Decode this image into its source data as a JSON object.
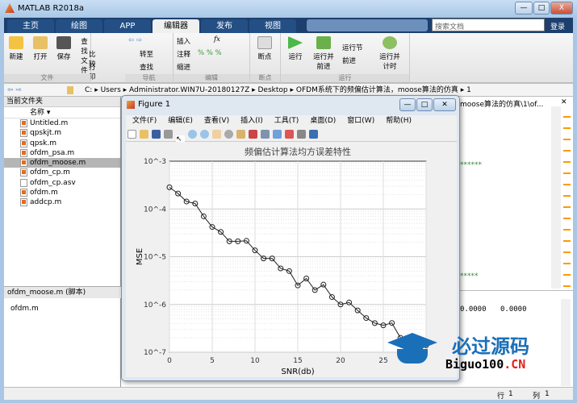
{
  "app": {
    "title": "MATLAB R2018a",
    "min": "—",
    "max": "□",
    "close": "X"
  },
  "tabs": [
    "主页",
    "绘图",
    "APP",
    "编辑器",
    "发布",
    "视图"
  ],
  "search": {
    "placeholder": "搜索文档"
  },
  "login": "登录",
  "ribbon": {
    "file": {
      "new": "新建",
      "open": "打开",
      "save": "保存",
      "find_files": "查找文件",
      "compare": "比较",
      "print": "打印",
      "label": "文件"
    },
    "nav": {
      "goto": "转至",
      "find": "查找",
      "label": "导航"
    },
    "edit": {
      "insert": "插入",
      "comment": "注释",
      "indent": "缩进",
      "fx": "fx",
      "label": "编辑"
    },
    "breakpoints": {
      "bp": "断点",
      "label": "断点"
    },
    "run": {
      "run": "运行",
      "run_advance": "运行并前进",
      "run_section": "运行节",
      "advance": "前进",
      "run_time": "运行并计时",
      "label": "运行"
    }
  },
  "address": {
    "path": [
      "C:",
      "Users",
      "Administrator.WIN7U-20180127Z",
      "Desktop",
      "OFDM系统下的频偏估计算法，moose算法的仿真",
      "1"
    ]
  },
  "current_folder": {
    "title": "当前文件夹",
    "column": "名称",
    "files": [
      {
        "name": "Untitled.m",
        "type": "m"
      },
      {
        "name": "qpskjt.m",
        "type": "m"
      },
      {
        "name": "qpsk.m",
        "type": "m"
      },
      {
        "name": "ofdm_psa.m",
        "type": "m"
      },
      {
        "name": "ofdm_moose.m",
        "type": "m",
        "selected": true
      },
      {
        "name": "ofdm_cp.m",
        "type": "m"
      },
      {
        "name": "ofdm_cp.asv",
        "type": "asv"
      },
      {
        "name": "ofdm.m",
        "type": "m"
      },
      {
        "name": "addcp.m",
        "type": "m"
      }
    ]
  },
  "details": {
    "title": "ofdm_moose.m  (脚本)",
    "content": "ofdm.m"
  },
  "editor": {
    "tab_title": "moose算法的仿真\\1\\of...",
    "stars1": "******",
    "stars2": "*****"
  },
  "command": {
    "v1": "0.0000",
    "v2": "0.0000"
  },
  "status": {
    "row_label": "行",
    "row": "1",
    "col_label": "列",
    "col": "1"
  },
  "figure": {
    "title": "Figure 1",
    "menu": [
      "文件(F)",
      "编辑(E)",
      "查看(V)",
      "插入(I)",
      "工具(T)",
      "桌面(D)",
      "窗口(W)",
      "帮助(H)"
    ]
  },
  "watermark": {
    "cn": "必过源码",
    "en": "Biguo100",
    "tld": ".CN"
  },
  "chart_data": {
    "type": "line",
    "title": "频偏估计算法均方误差特性",
    "xlabel": "SNR(db)",
    "ylabel": "MSE",
    "xlim": [
      0,
      30
    ],
    "ylim": [
      1e-07,
      0.001
    ],
    "yscale": "log",
    "grid": true,
    "marker": "circle",
    "xticks": [
      0,
      5,
      10,
      15,
      20,
      25
    ],
    "yticks": [
      "10^-7",
      "10^-6",
      "10^-5",
      "10^-4",
      "10^-3"
    ],
    "x": [
      0,
      1,
      2,
      3,
      4,
      5,
      6,
      7,
      8,
      9,
      10,
      11,
      12,
      13,
      14,
      15,
      16,
      17,
      18,
      19,
      20,
      21,
      22,
      23,
      24,
      25,
      26,
      27,
      28,
      29,
      30
    ],
    "y": [
      0.000284,
      0.00021,
      0.000143,
      0.00013,
      7e-05,
      4.2e-05,
      3.3e-05,
      2.1e-05,
      2.1e-05,
      2.15e-05,
      1.36e-05,
      9.2e-06,
      9.2e-06,
      5.7e-06,
      5e-06,
      2.5e-06,
      3.5e-06,
      2e-06,
      2.6e-06,
      1.43e-06,
      1e-06,
      1.1e-06,
      7.5e-07,
      5.2e-07,
      4.07e-07,
      3.66e-07,
      4.1e-07,
      2e-07,
      1.3e-07,
      1e-07,
      1.4e-07
    ]
  }
}
